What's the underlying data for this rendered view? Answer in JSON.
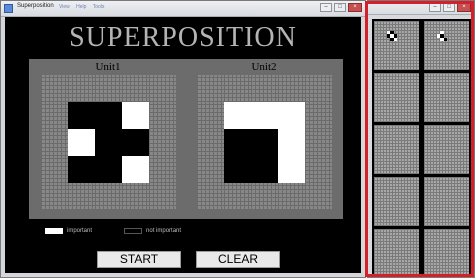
{
  "main_window": {
    "title": "Superposition",
    "menu": [
      "View",
      "Help",
      "Tools"
    ],
    "controls": {
      "minimize": "–",
      "maximize": "□",
      "close": "×"
    }
  },
  "app": {
    "heading": "SUPERPOSITION",
    "unit1": {
      "label": "Unit1",
      "cells": [
        [
          "gray",
          "gray",
          "gray",
          "gray",
          "gray"
        ],
        [
          "gray",
          "black",
          "black",
          "white",
          "gray"
        ],
        [
          "gray",
          "white",
          "black",
          "black",
          "gray"
        ],
        [
          "gray",
          "black",
          "black",
          "white",
          "gray"
        ],
        [
          "gray",
          "gray",
          "gray",
          "gray",
          "gray"
        ]
      ]
    },
    "unit2": {
      "label": "Unit2",
      "cells": [
        [
          "gray",
          "gray",
          "gray",
          "gray",
          "gray"
        ],
        [
          "gray",
          "white",
          "white",
          "white",
          "gray"
        ],
        [
          "gray",
          "black",
          "black",
          "white",
          "gray"
        ],
        [
          "gray",
          "black",
          "black",
          "white",
          "gray"
        ],
        [
          "gray",
          "gray",
          "gray",
          "gray",
          "gray"
        ]
      ]
    },
    "legend": {
      "important": "important",
      "not_important": "not important"
    },
    "buttons": {
      "start": "START",
      "clear": "CLEAR"
    }
  },
  "side_window": {
    "controls": {
      "minimize": "–",
      "maximize": "□",
      "close": "×"
    },
    "thumbnails": [
      {
        "pattern": [
          [
            "w",
            "b",
            "t"
          ],
          [
            "b",
            "w",
            "b"
          ],
          [
            "t",
            "b",
            "w"
          ]
        ]
      },
      {
        "pattern": [
          [
            "t",
            "w",
            "t"
          ],
          [
            "w",
            "b",
            "t"
          ],
          [
            "t",
            "w",
            "b"
          ]
        ]
      },
      {
        "pattern": null
      },
      {
        "pattern": null
      },
      {
        "pattern": null
      },
      {
        "pattern": null
      },
      {
        "pattern": null
      },
      {
        "pattern": null
      },
      {
        "pattern": null
      },
      {
        "pattern": null
      }
    ]
  },
  "colors": {
    "highlight": "#d4202a",
    "panel_gray": "#6c6c6c",
    "background": "#000000"
  }
}
